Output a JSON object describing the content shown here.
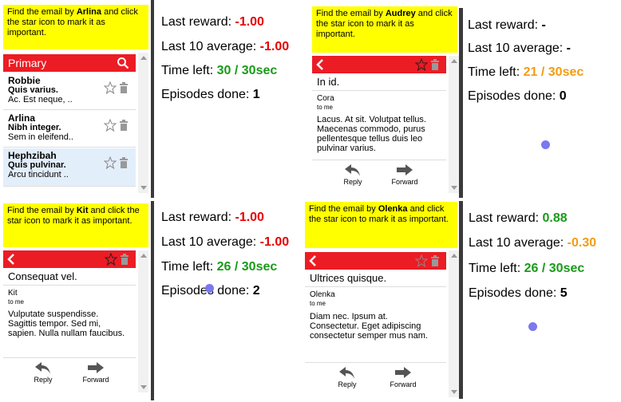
{
  "episodes": [
    {
      "task_prefix": "Find the email by ",
      "task_name": "Arlina",
      "task_suffix": " and click the star icon to mark it as important.",
      "inbox_title": "Primary",
      "emails": [
        {
          "sender": "Robbie",
          "subject": "Quis varius.",
          "snippet": "Ac. Est neque, .."
        },
        {
          "sender": "Arlina",
          "subject": "Nibh integer.",
          "snippet": "Sem in eleifend.."
        },
        {
          "sender": "Hephzibah",
          "subject": "Quis pulvinar.",
          "snippet": "Arcu tincidunt .."
        }
      ],
      "last_reward_label": "Last reward: ",
      "last_reward": "-1.00",
      "last10_label": "Last 10 average: ",
      "last10": "-1.00",
      "time_label": "Time left: ",
      "time_left": "30 / 30sec",
      "episodes_label": "Episodes done: ",
      "episodes_done": "1"
    },
    {
      "task_prefix": "Find the email by ",
      "task_name": "Audrey",
      "task_suffix": " and click the star icon to mark it as important.",
      "subject": "In id.",
      "from": "Cora",
      "to": "to me",
      "body": "Lacus. At sit. Volutpat tellus. Maecenas commodo, purus pellentesque tellus duis leo pulvinar varius.",
      "reply_label": "Reply",
      "forward_label": "Forward",
      "last_reward_label": "Last reward: ",
      "last_reward": "-",
      "last10_label": "Last 10 average: ",
      "last10": "-",
      "time_label": "Time left: ",
      "time_left": "21 / 30sec",
      "episodes_label": "Episodes done: ",
      "episodes_done": "0"
    },
    {
      "task_prefix": "Find the email by ",
      "task_name": "Kit",
      "task_suffix": " and click the star icon to mark it as important.",
      "subject": "Consequat vel.",
      "from": "Kit",
      "to": "to me",
      "body": "Vulputate suspendisse. Sagittis tempor. Sed mi, sapien. Nulla nullam faucibus.",
      "reply_label": "Reply",
      "forward_label": "Forward",
      "last_reward_label": "Last reward: ",
      "last_reward": "-1.00",
      "last10_label": "Last 10 average: ",
      "last10": "-1.00",
      "time_label": "Time left: ",
      "time_left": "26 / 30sec",
      "episodes_label": "Episodes done: ",
      "episodes_done": "2"
    },
    {
      "task_prefix": "Find the email by ",
      "task_name": "Olenka",
      "task_suffix": " and click the star icon to mark it as important.",
      "subject": "Ultrices quisque.",
      "from": "Olenka",
      "to": "to me",
      "body": "Diam nec. Ipsum at. Consectetur. Eget adipiscing consectetur semper mus nam.",
      "reply_label": "Reply",
      "forward_label": "Forward",
      "last_reward_label": "Last reward: ",
      "last_reward": "0.88",
      "last10_label": "Last 10 average: ",
      "last10": "-0.30",
      "time_label": "Time left: ",
      "time_left": "26 / 30sec",
      "episodes_label": "Episodes done: ",
      "episodes_done": "5"
    }
  ],
  "colors": {
    "task_bg": "#ffff00",
    "header_red": "#ec1c24",
    "reward_red": "#e60000",
    "reward_green": "#1a9a1a",
    "warn_orange": "#f39c12",
    "cursor": "#7b78f0"
  }
}
